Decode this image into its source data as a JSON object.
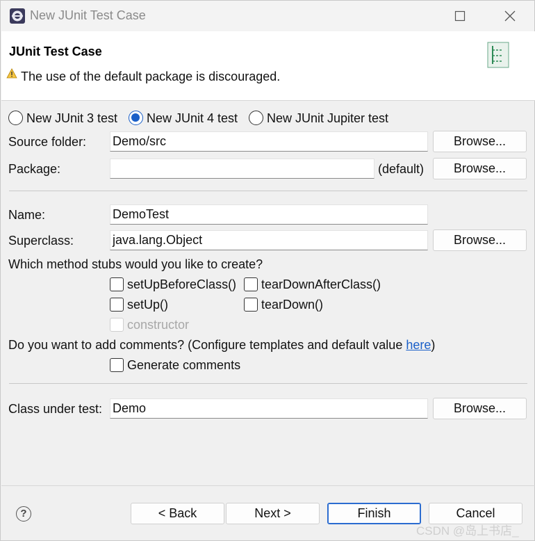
{
  "window": {
    "title": "New JUnit Test Case"
  },
  "banner": {
    "title": "JUnit Test Case",
    "message": "The use of the default package is discouraged."
  },
  "junit_version": {
    "options": [
      {
        "label": "New JUnit 3 test",
        "selected": false
      },
      {
        "label": "New JUnit 4 test",
        "selected": true
      },
      {
        "label": "New JUnit Jupiter test",
        "selected": false
      }
    ]
  },
  "source_folder": {
    "label": "Source folder:",
    "value": "Demo/src",
    "browse": "Browse..."
  },
  "package": {
    "label": "Package:",
    "value": "",
    "suffix": "(default)",
    "browse": "Browse..."
  },
  "name": {
    "label": "Name:",
    "value": "DemoTest"
  },
  "superclass": {
    "label": "Superclass:",
    "value": "java.lang.Object",
    "browse": "Browse..."
  },
  "stubs": {
    "question": "Which method stubs would you like to create?",
    "items": [
      {
        "label": "setUpBeforeClass()",
        "checked": false,
        "enabled": true
      },
      {
        "label": "tearDownAfterClass()",
        "checked": false,
        "enabled": true
      },
      {
        "label": "setUp()",
        "checked": false,
        "enabled": true
      },
      {
        "label": "tearDown()",
        "checked": false,
        "enabled": true
      },
      {
        "label": "constructor",
        "checked": false,
        "enabled": false
      }
    ]
  },
  "comments": {
    "question_prefix": "Do you want to add comments? (Configure templates and default value ",
    "link": "here",
    "question_suffix": ")",
    "generate_label": "Generate comments",
    "checked": false
  },
  "class_under_test": {
    "label": "Class under test:",
    "value": "Demo",
    "browse": "Browse..."
  },
  "footer": {
    "help": "?",
    "back": "< Back",
    "next": "Next >",
    "finish": "Finish",
    "cancel": "Cancel"
  },
  "watermark": "CSDN @岛上书店_",
  "colors": {
    "accent": "#1a5fc8",
    "link": "#1a5fc8"
  }
}
